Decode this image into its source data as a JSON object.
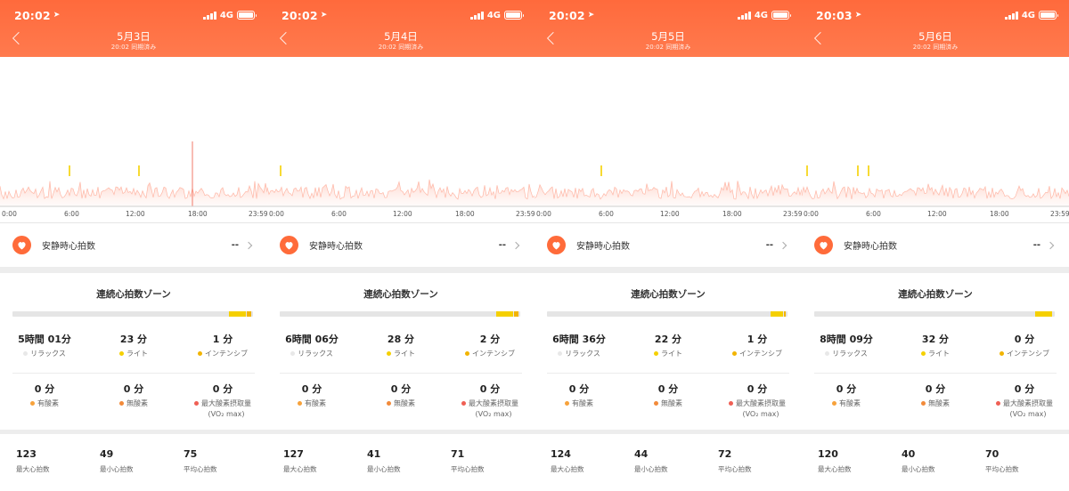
{
  "colors": {
    "header": "#ff6a3c",
    "relax": "#e8e8e8",
    "light": "#f5d000",
    "intensive": "#f2b400",
    "aerobic": "#f7a23b",
    "anaerobic": "#f28a3a",
    "vo2": "#ef5f54",
    "heart_icon": "#ff6b3a"
  },
  "icons": [
    "back-arrow-icon",
    "location-arrow-icon",
    "signal-bars-icon",
    "battery-icon",
    "heart-icon",
    "chevron-right-icon"
  ],
  "screens": [
    {
      "status": {
        "time": "20:02",
        "network": "4G"
      },
      "header": {
        "title": "5月3日",
        "subtitle": "20:02 同期済み"
      },
      "chart": {
        "ticks": [
          "0:00",
          "6:00",
          "12:00",
          "18:00",
          "23:59"
        ],
        "seed": 3,
        "highlight": 0.72,
        "spikes": [
          0.26,
          0.52
        ]
      },
      "resting": {
        "label": "安静時心拍数",
        "value": "--"
      },
      "zones": {
        "title": "連続心拍数ゾーン",
        "bar": {
          "relax": 0.9,
          "light": 0.07,
          "intensive": 0.02
        },
        "row1": [
          {
            "value": "5時間 01分",
            "label": "リラックス",
            "dot": "relax"
          },
          {
            "value": "23 分",
            "label": "ライト",
            "dot": "light"
          },
          {
            "value": "1 分",
            "label": "インテンシブ",
            "dot": "intensive"
          }
        ],
        "row2": [
          {
            "value": "0 分",
            "label": "有酸素",
            "dot": "aerobic"
          },
          {
            "value": "0 分",
            "label": "無酸素",
            "dot": "anaerobic"
          },
          {
            "value": "0 分",
            "label": "最大酸素摂取量",
            "label2": "(VO₂ max)",
            "dot": "vo2"
          }
        ]
      },
      "stats": [
        {
          "value": "123",
          "label": "最大心拍数"
        },
        {
          "value": "49",
          "label": "最小心拍数"
        },
        {
          "value": "75",
          "label": "平均心拍数"
        }
      ]
    },
    {
      "status": {
        "time": "20:02",
        "network": "4G"
      },
      "header": {
        "title": "5月4日",
        "subtitle": "20:02 同期済み"
      },
      "chart": {
        "ticks": [
          "0:00",
          "6:00",
          "12:00",
          "18:00",
          "23:59"
        ],
        "seed": 4,
        "highlight": -1,
        "spikes": [
          0.05
        ]
      },
      "resting": {
        "label": "安静時心拍数",
        "value": "--"
      },
      "zones": {
        "title": "連続心拍数ゾーン",
        "bar": {
          "relax": 0.9,
          "light": 0.07,
          "intensive": 0.02
        },
        "row1": [
          {
            "value": "6時間 06分",
            "label": "リラックス",
            "dot": "relax"
          },
          {
            "value": "28 分",
            "label": "ライト",
            "dot": "light"
          },
          {
            "value": "2 分",
            "label": "インテンシブ",
            "dot": "intensive"
          }
        ],
        "row2": [
          {
            "value": "0 分",
            "label": "有酸素",
            "dot": "aerobic"
          },
          {
            "value": "0 分",
            "label": "無酸素",
            "dot": "anaerobic"
          },
          {
            "value": "0 分",
            "label": "最大酸素摂取量",
            "label2": "(VO₂ max)",
            "dot": "vo2"
          }
        ]
      },
      "stats": [
        {
          "value": "127",
          "label": "最大心拍数"
        },
        {
          "value": "41",
          "label": "最小心拍数"
        },
        {
          "value": "71",
          "label": "平均心拍数"
        }
      ]
    },
    {
      "status": {
        "time": "20:02",
        "network": "4G"
      },
      "header": {
        "title": "5月5日",
        "subtitle": "20:02 同期済み"
      },
      "chart": {
        "ticks": [
          "0:00",
          "6:00",
          "12:00",
          "18:00",
          "23:59"
        ],
        "seed": 5,
        "highlight": -1,
        "spikes": [
          0.25
        ]
      },
      "resting": {
        "label": "安静時心拍数",
        "value": "--"
      },
      "zones": {
        "title": "連続心拍数ゾーン",
        "bar": {
          "relax": 0.93,
          "light": 0.05,
          "intensive": 0.01
        },
        "row1": [
          {
            "value": "6時間 36分",
            "label": "リラックス",
            "dot": "relax"
          },
          {
            "value": "22 分",
            "label": "ライト",
            "dot": "light"
          },
          {
            "value": "1 分",
            "label": "インテンシブ",
            "dot": "intensive"
          }
        ],
        "row2": [
          {
            "value": "0 分",
            "label": "有酸素",
            "dot": "aerobic"
          },
          {
            "value": "0 分",
            "label": "無酸素",
            "dot": "anaerobic"
          },
          {
            "value": "0 分",
            "label": "最大酸素摂取量",
            "label2": "(VO₂ max)",
            "dot": "vo2"
          }
        ]
      },
      "stats": [
        {
          "value": "124",
          "label": "最大心拍数"
        },
        {
          "value": "44",
          "label": "最小心拍数"
        },
        {
          "value": "72",
          "label": "平均心拍数"
        }
      ]
    },
    {
      "status": {
        "time": "20:03",
        "network": "4G"
      },
      "header": {
        "title": "5月6日",
        "subtitle": "20:02 同期済み"
      },
      "chart": {
        "ticks": [
          "0:00",
          "6:00",
          "12:00",
          "18:00",
          "23:59"
        ],
        "seed": 6,
        "highlight": -1,
        "spikes": [
          0.02,
          0.21,
          0.25
        ]
      },
      "resting": {
        "label": "安静時心拍数",
        "value": "--"
      },
      "zones": {
        "title": "連続心拍数ゾーン",
        "bar": {
          "relax": 0.92,
          "light": 0.07,
          "intensive": 0.0
        },
        "row1": [
          {
            "value": "8時間 09分",
            "label": "リラックス",
            "dot": "relax"
          },
          {
            "value": "32 分",
            "label": "ライト",
            "dot": "light"
          },
          {
            "value": "0 分",
            "label": "インテンシブ",
            "dot": "intensive"
          }
        ],
        "row2": [
          {
            "value": "0 分",
            "label": "有酸素",
            "dot": "aerobic"
          },
          {
            "value": "0 分",
            "label": "無酸素",
            "dot": "anaerobic"
          },
          {
            "value": "0 分",
            "label": "最大酸素摂取量",
            "label2": "(VO₂ max)",
            "dot": "vo2"
          }
        ]
      },
      "stats": [
        {
          "value": "120",
          "label": "最大心拍数"
        },
        {
          "value": "40",
          "label": "最小心拍数"
        },
        {
          "value": "70",
          "label": "平均心拍数"
        }
      ]
    }
  ]
}
